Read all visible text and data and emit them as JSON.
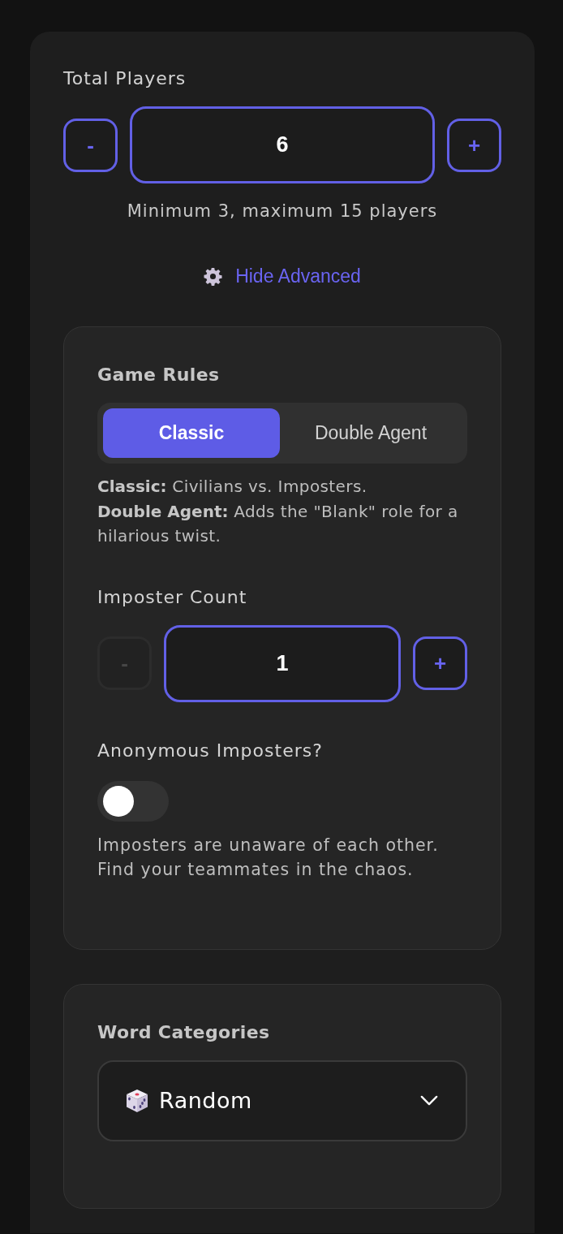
{
  "total_players": {
    "label": "Total Players",
    "decrement": {
      "label": "-",
      "disabled": false
    },
    "value": "6",
    "increment": {
      "label": "+",
      "disabled": false
    },
    "hint": "Minimum 3, maximum 15 players"
  },
  "advanced_link": {
    "label": "Hide Advanced"
  },
  "game_rules": {
    "title": "Game Rules",
    "modes": [
      {
        "label": "Classic",
        "selected": true
      },
      {
        "label": "Double Agent",
        "selected": false
      }
    ],
    "description": [
      "**Classic:** Civilians vs. Imposters.",
      "**Double Agent:** Adds the \"Blank\" role for a hilarious twist."
    ]
  },
  "imposter_count": {
    "label": "Imposter Count",
    "decrement": {
      "label": "-",
      "disabled": true
    },
    "value": "1",
    "increment": {
      "label": "+",
      "disabled": false
    }
  },
  "anonymous_imposters": {
    "label": "Anonymous Imposters?",
    "on": false,
    "description": "Imposters are unaware of each other. Find your teammates in the chaos."
  },
  "word_categories": {
    "title": "Word Categories",
    "select": {
      "value": "Random"
    }
  }
}
